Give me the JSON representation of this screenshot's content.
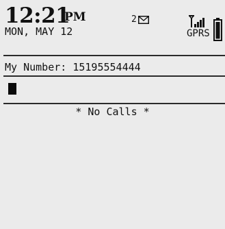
{
  "status_bar": {
    "time": "12:21",
    "ampm": "PM",
    "date": "MON, MAY 12",
    "unread_messages": "2",
    "message_icon": "envelope-icon",
    "signal_icon": "signal-strength-icon",
    "network": "GPRS",
    "battery_icon": "battery-icon"
  },
  "phone": {
    "my_number": "My Number: 15195554444",
    "empty_list_text": "* No Calls *"
  },
  "colors": {
    "screen_background": "#ebebeb",
    "text": "#111111",
    "divider": "#2a2a2a"
  }
}
